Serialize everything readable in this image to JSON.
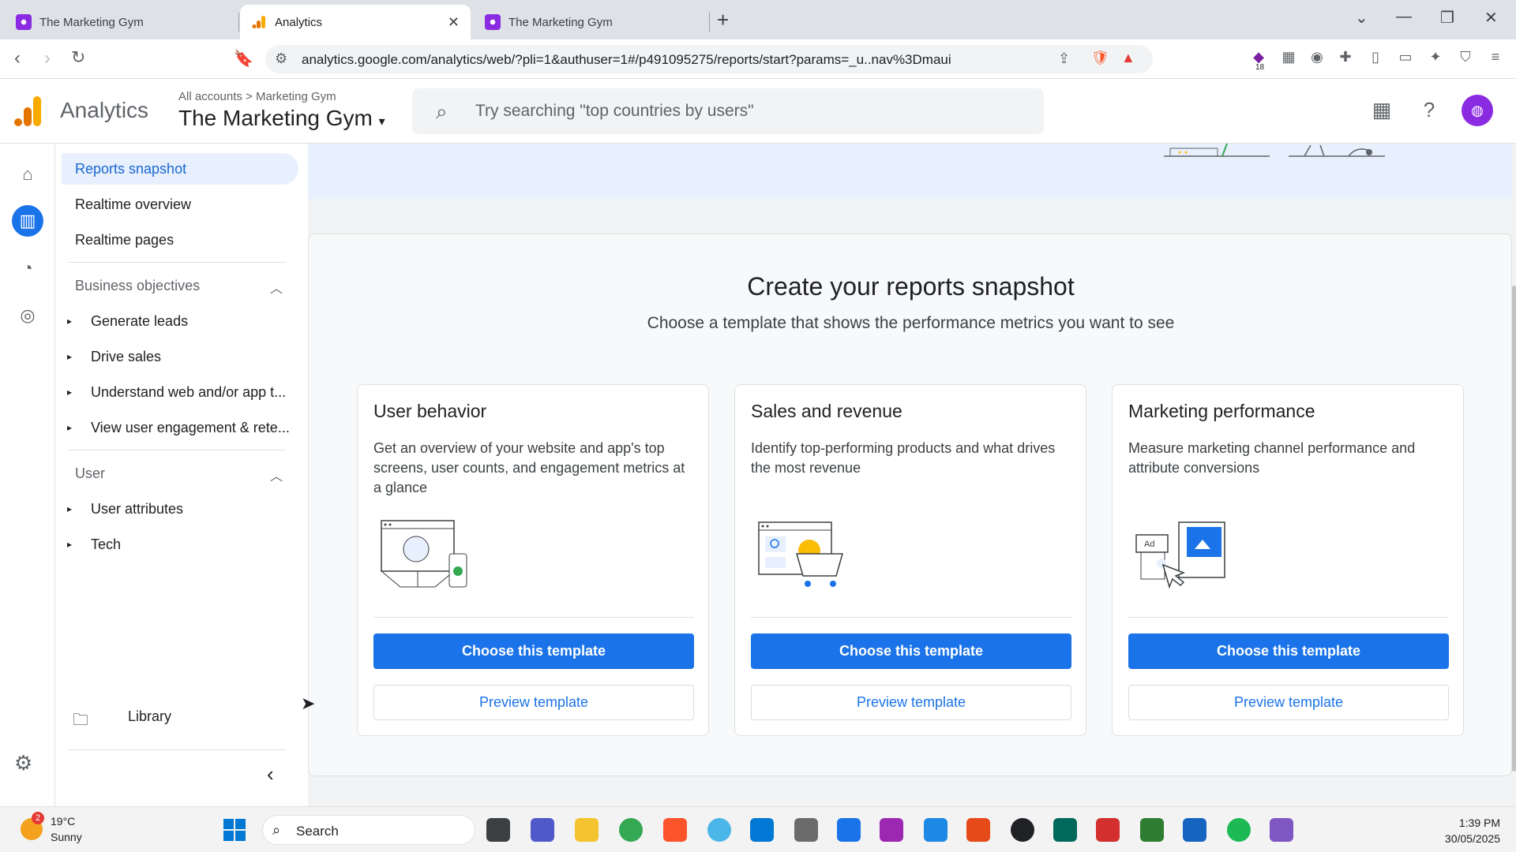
{
  "browser": {
    "tabs": [
      {
        "title": "The Marketing Gym"
      },
      {
        "title": "Analytics"
      },
      {
        "title": "The Marketing Gym"
      }
    ],
    "url": "analytics.google.com/analytics/web/?pli=1&authuser=1#/p491095275/reports/start?params=_u..nav%3Dmaui",
    "ext_badge": "18"
  },
  "header": {
    "product": "Analytics",
    "breadcrumb": "All accounts > Marketing Gym",
    "property": "The Marketing Gym",
    "search_placeholder": "Try searching \"top countries by users\""
  },
  "sidebar": {
    "items": [
      {
        "label": "Reports snapshot"
      },
      {
        "label": "Realtime overview"
      },
      {
        "label": "Realtime pages"
      }
    ],
    "business_objectives": {
      "heading": "Business objectives",
      "items": [
        "Generate leads",
        "Drive sales",
        "Understand web and/or app t...",
        "View user engagement & rete..."
      ]
    },
    "user": {
      "heading": "User",
      "items": [
        "User attributes",
        "Tech"
      ]
    },
    "library": "Library"
  },
  "main": {
    "title": "Create your reports snapshot",
    "subtitle": "Choose a template that shows the performance metrics you want to see",
    "cards": [
      {
        "title": "User behavior",
        "desc": "Get an overview of your website and app's top screens, user counts, and engagement metrics at a glance",
        "primary": "Choose this template",
        "secondary": "Preview template"
      },
      {
        "title": "Sales and revenue",
        "desc": "Identify top-performing products and what drives the most revenue",
        "primary": "Choose this template",
        "secondary": "Preview template"
      },
      {
        "title": "Marketing performance",
        "desc": "Measure marketing channel performance and attribute conversions",
        "primary": "Choose this template",
        "secondary": "Preview template"
      }
    ],
    "ad_label": "Ad"
  },
  "taskbar": {
    "weather": {
      "temp": "19°C",
      "cond": "Sunny",
      "badge": "2"
    },
    "search": "Search",
    "time": "1:39 PM",
    "date": "30/05/2025"
  },
  "colors": {
    "accent": "#1a73e8",
    "nav_active_bg": "#e8f0fe",
    "logo_orange": "#f9ab00",
    "logo_dark_orange": "#e37400"
  }
}
